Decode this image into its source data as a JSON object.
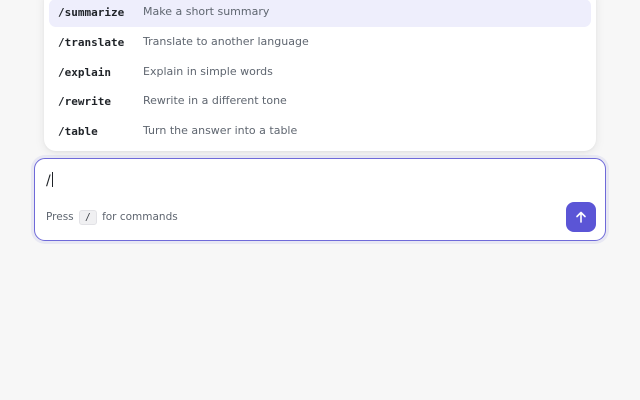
{
  "command_menu": {
    "items": [
      {
        "command": "/summarize",
        "description": "Make a short summary",
        "highlighted": true
      },
      {
        "command": "/translate",
        "description": "Translate to another language",
        "highlighted": false
      },
      {
        "command": "/explain",
        "description": "Explain in simple words",
        "highlighted": false
      },
      {
        "command": "/rewrite",
        "description": "Rewrite in a different tone",
        "highlighted": false
      },
      {
        "command": "/table",
        "description": "Turn the answer into a table",
        "highlighted": false
      }
    ]
  },
  "composer": {
    "input_value": "/",
    "hint_prefix": "Press",
    "hint_key": "/",
    "hint_suffix": "for commands",
    "send_icon": "arrow-up-icon"
  },
  "colors": {
    "accent": "#5b55d6",
    "highlight": "#eeeefc",
    "border_focus": "#6f6ad9",
    "background": "#f7f7f7"
  }
}
